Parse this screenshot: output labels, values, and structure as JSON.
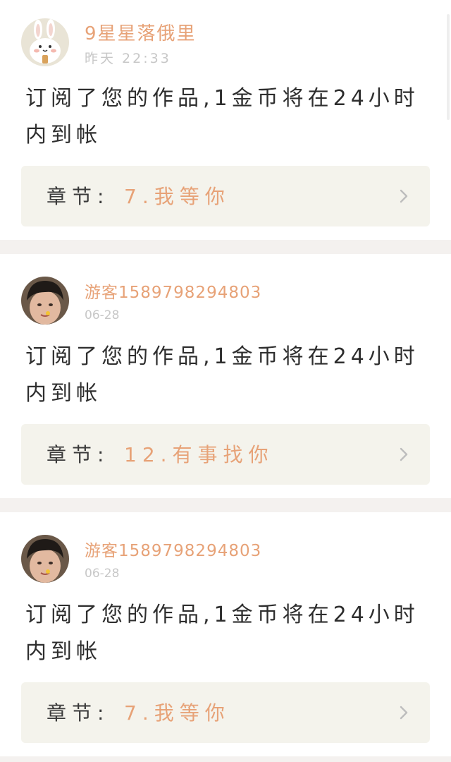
{
  "notifications": [
    {
      "username": "9星星落俄里",
      "time": "昨天 22:33",
      "message": "订阅了您的作品,1金币将在24小时内到帐",
      "chapter_label": "章节:",
      "chapter_title": "7.我等你",
      "avatar": "bunny-avatar"
    },
    {
      "username": "游客1589798294803",
      "time": "06-28",
      "message": "订阅了您的作品,1金币将在24小时内到帐",
      "chapter_label": "章节:",
      "chapter_title": "12.有事找你",
      "avatar": "person-photo-avatar"
    },
    {
      "username": "游客1589798294803",
      "time": "06-28",
      "message": "订阅了您的作品,1金币将在24小时内到帐",
      "chapter_label": "章节:",
      "chapter_title": "7.我等你",
      "avatar": "person-photo-avatar"
    }
  ],
  "colors": {
    "accent": "#e7a277",
    "page_background": "#f4f1ef",
    "chapter_box": "#f4f3ec",
    "text": "#2e2e2e",
    "muted": "#c7c7c7"
  }
}
